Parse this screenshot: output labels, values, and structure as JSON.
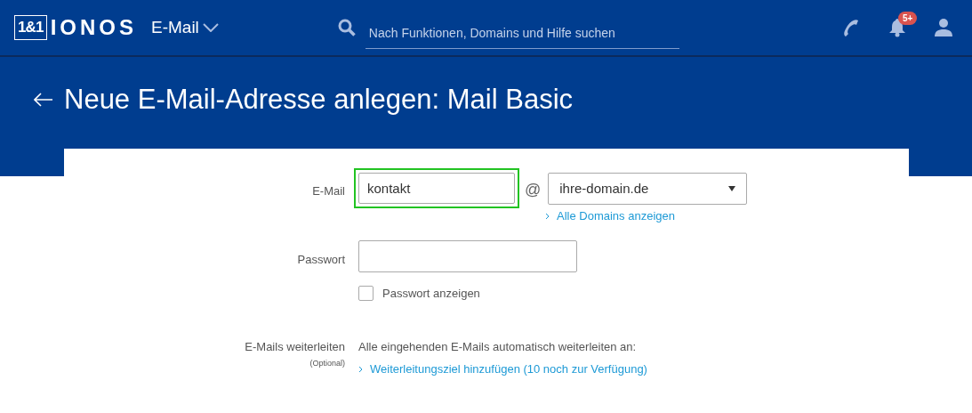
{
  "header": {
    "logo_box": "1&1",
    "logo_text": "IONOS",
    "product": "E-Mail",
    "search": {
      "placeholder": "Nach Funktionen, Domains und Hilfe suchen"
    },
    "notification_badge": "5+"
  },
  "page_title": "Neue E-Mail-Adresse anlegen: Mail Basic",
  "form": {
    "email": {
      "label": "E-Mail",
      "value": "kontakt",
      "highlighted": true,
      "at": "@",
      "domain": "ihre-domain.de",
      "domains_link": "Alle Domains anzeigen"
    },
    "password": {
      "label": "Passwort",
      "show_checkbox": {
        "label": "Passwort anzeigen",
        "checked": false
      }
    },
    "forwarding": {
      "label": "E-Mails weiterleiten",
      "optional": "(Optional)",
      "text": "Alle eingehenden E-Mails automatisch weiterleiten an:",
      "link": "Weiterleitungsziel hinzufügen (10 noch zur Verfügung)"
    }
  }
}
